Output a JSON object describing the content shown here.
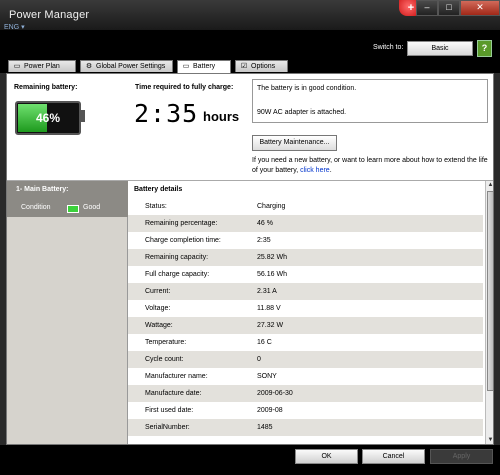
{
  "window": {
    "title": "Power Manager",
    "lang": "ENG ▾",
    "app_icon_symbol": "+",
    "help_symbol": "?",
    "controls": [
      "‒",
      "□",
      "✕"
    ]
  },
  "switch": {
    "label": "Switch to:",
    "value": "Basic"
  },
  "tabs": [
    {
      "label": "Power Plan",
      "icon": "power-plan-icon"
    },
    {
      "label": "Global Power Settings",
      "icon": "gear-icon"
    },
    {
      "label": "Battery",
      "icon": "battery-icon"
    },
    {
      "label": "Options",
      "icon": "checkbox-icon"
    }
  ],
  "battery_summary": {
    "remaining_label": "Remaining battery:",
    "remaining_value": "46%",
    "remaining_fraction": 0.46,
    "time_label": "Time required to fully charge:",
    "time_value": "2:35",
    "time_unit": "hours",
    "condition_message": "The battery is in good condition.",
    "adapter_message": "90W AC adapter is attached.",
    "maintenance_button": "Battery Maintenance...",
    "info_text": "If you need a new battery, or want to learn more about how to extend the life of your battery,",
    "info_link": "click here",
    "info_end": "."
  },
  "main_battery": {
    "header": "1- Main Battery:",
    "condition_label": "Condition",
    "condition_value": "Good"
  },
  "details": {
    "header": "Battery details",
    "rows": [
      {
        "key": "Status:",
        "value": "Charging"
      },
      {
        "key": "Remaining percentage:",
        "value": "46 %"
      },
      {
        "key": "Charge completion time:",
        "value": "2:35"
      },
      {
        "key": "Remaining capacity:",
        "value": "25.82 Wh"
      },
      {
        "key": "Full charge capacity:",
        "value": "56.16 Wh"
      },
      {
        "key": "Current:",
        "value": "2.31 A"
      },
      {
        "key": "Voltage:",
        "value": "11.88 V"
      },
      {
        "key": "Wattage:",
        "value": "27.32 W"
      },
      {
        "key": "Temperature:",
        "value": "16 C"
      },
      {
        "key": "Cycle count:",
        "value": "0"
      },
      {
        "key": "Manufacturer name:",
        "value": "SONY"
      },
      {
        "key": "Manufacture date:",
        "value": "2009-06-30"
      },
      {
        "key": "First used date:",
        "value": "2009-08"
      },
      {
        "key": "SerialNumber:",
        "value": "1485"
      }
    ]
  },
  "footer": {
    "ok": "OK",
    "cancel": "Cancel",
    "apply": "Apply"
  }
}
